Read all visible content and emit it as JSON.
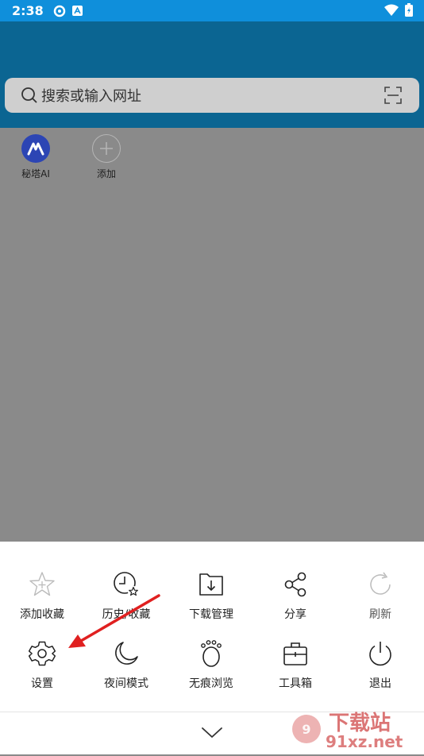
{
  "status_bar": {
    "time": "2:38"
  },
  "search": {
    "placeholder": "搜索或输入网址"
  },
  "shortcuts": [
    {
      "label": "秘塔AI"
    },
    {
      "label": "添加"
    }
  ],
  "menu": {
    "row1": [
      {
        "label": "添加收藏",
        "icon": "star-plus-icon"
      },
      {
        "label": "历史/收藏",
        "icon": "clock-star-icon"
      },
      {
        "label": "下载管理",
        "icon": "download-folder-icon"
      },
      {
        "label": "分享",
        "icon": "share-icon"
      },
      {
        "label": "刷新",
        "icon": "refresh-icon"
      }
    ],
    "row2": [
      {
        "label": "设置",
        "icon": "gear-icon"
      },
      {
        "label": "夜间模式",
        "icon": "moon-icon"
      },
      {
        "label": "无痕浏览",
        "icon": "paw-icon"
      },
      {
        "label": "工具箱",
        "icon": "toolbox-icon"
      },
      {
        "label": "退出",
        "icon": "power-icon"
      }
    ]
  },
  "watermark": {
    "brand": "下载站",
    "domain": "91xz.net"
  },
  "colors": {
    "status_bar": "#0f8fdb",
    "header": "#0b6592",
    "overlay": "#8a8a8a",
    "annotation_arrow": "#e02020"
  }
}
